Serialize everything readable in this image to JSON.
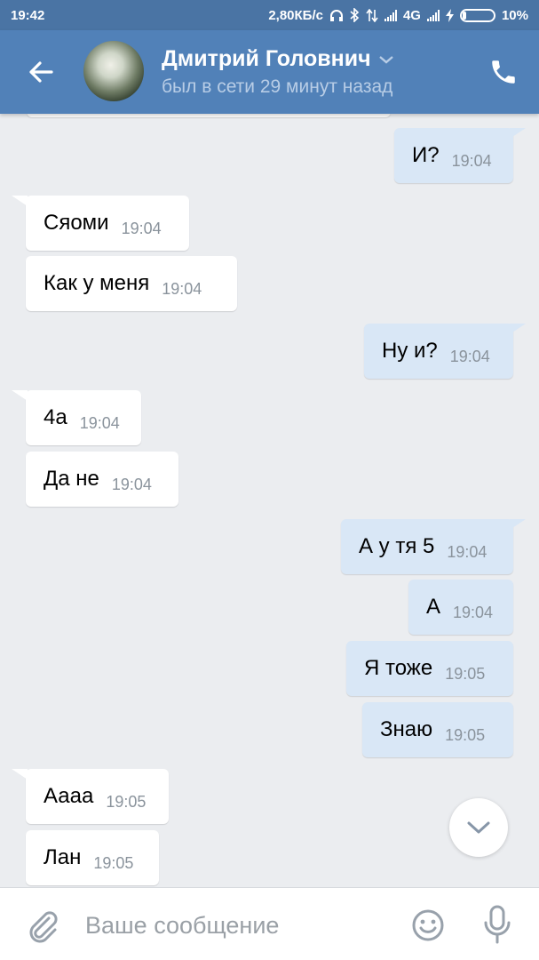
{
  "status_bar": {
    "time": "19:42",
    "net_speed": "2,80КБ/с",
    "network": "4G",
    "battery": "10%",
    "battery_level": 0.1
  },
  "header": {
    "contact_name": "Дмитрий Головнич",
    "last_seen": "был в сети 29 минут назад"
  },
  "messages": [
    {
      "dir": "out",
      "text": "И?",
      "time": "19:04"
    },
    {
      "dir": "in",
      "text": "Сяоми",
      "time": "19:04"
    },
    {
      "dir": "in",
      "text": "Как у меня",
      "time": "19:04"
    },
    {
      "dir": "out",
      "text": "Ну и?",
      "time": "19:04"
    },
    {
      "dir": "in",
      "text": "4а",
      "time": "19:04"
    },
    {
      "dir": "in",
      "text": "Да не",
      "time": "19:04"
    },
    {
      "dir": "out",
      "text": "А у тя 5",
      "time": "19:04"
    },
    {
      "dir": "out",
      "text": "А",
      "time": "19:04"
    },
    {
      "dir": "out",
      "text": "Я тоже",
      "time": "19:05"
    },
    {
      "dir": "out",
      "text": "Знаю",
      "time": "19:05"
    },
    {
      "dir": "in",
      "text": "Аааа",
      "time": "19:05"
    },
    {
      "dir": "in",
      "text": "Лан",
      "time": "19:05"
    }
  ],
  "composer": {
    "placeholder": "Ваше сообщение"
  },
  "icons": {
    "back": "arrow-left-icon",
    "call": "phone-icon",
    "attach": "paperclip-icon",
    "emoji": "smile-icon",
    "voice": "microphone-icon",
    "scroll": "chevron-down-icon"
  },
  "colors": {
    "header": "#5181b8",
    "status_bar": "#4a74a4",
    "outgoing_bubble": "#d9e7f6",
    "incoming_bubble": "#ffffff",
    "chat_background": "#ebedf0"
  }
}
